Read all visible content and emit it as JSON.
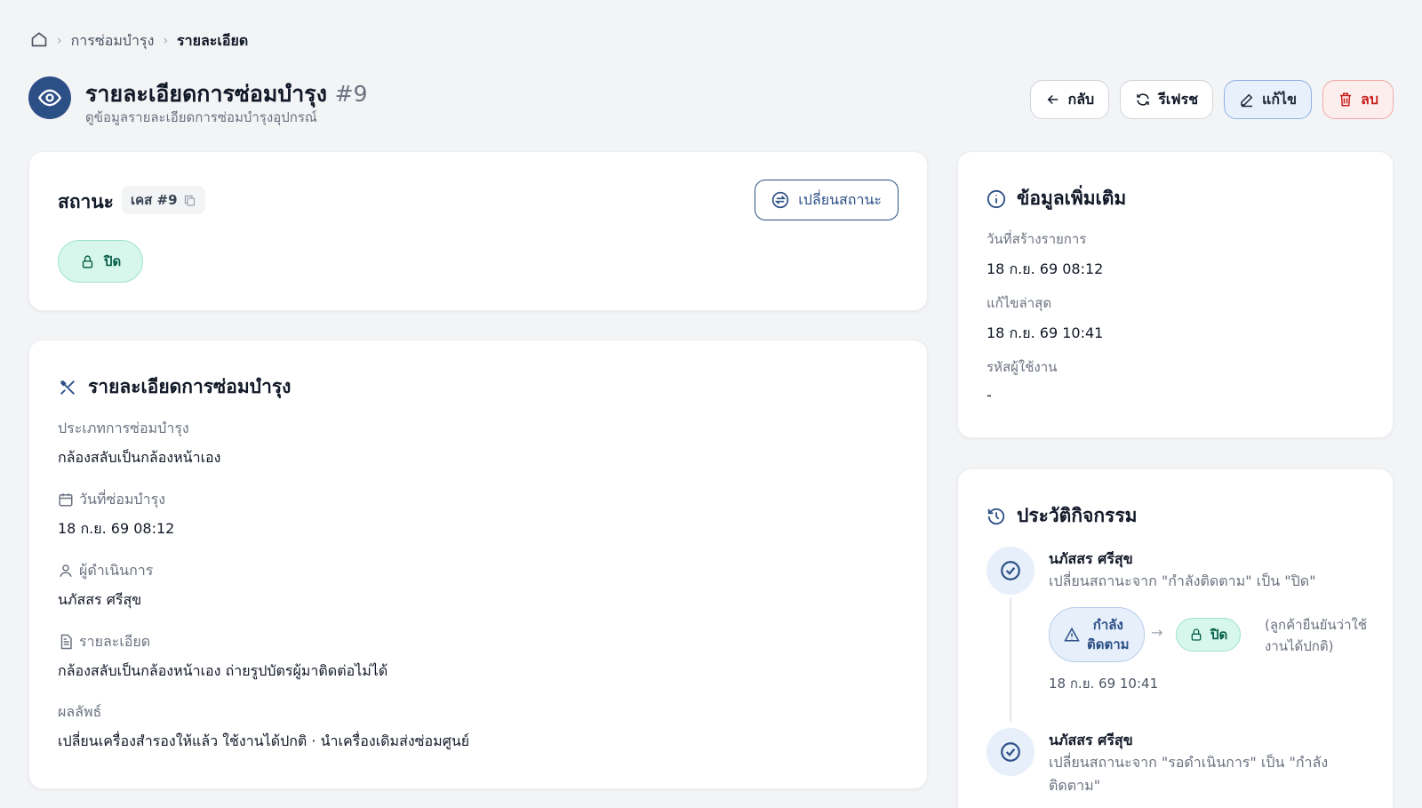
{
  "breadcrumb": {
    "parent": "การซ่อมบำรุง",
    "current": "รายละเอียด"
  },
  "header": {
    "title": "รายละเอียดการซ่อมบำรุง",
    "number": "#9",
    "subtitle": "ดูข้อมูลรายละเอียดการซ่อมบำรุงอุปกรณ์"
  },
  "actions": {
    "back": "กลับ",
    "refresh": "รีเฟรช",
    "edit": "แก้ไข",
    "delete": "ลบ"
  },
  "status": {
    "label": "สถานะ",
    "case": "เคส #9",
    "change_button": "เปลี่ยนสถานะ",
    "current": "ปิด"
  },
  "details": {
    "title": "รายละเอียดการซ่อมบำรุง",
    "type_label": "ประเภทการซ่อมบำรุง",
    "type_value": "กล้องสลับเป็นกล้องหน้าเอง",
    "date_label": "วันที่ซ่อมบำรุง",
    "date_value": "18 ก.ย. 69 08:12",
    "operator_label": "ผู้ดำเนินการ",
    "operator_value": "นภัสสร ศรีสุข",
    "detail_label": "รายละเอียด",
    "detail_value": "กล้องสลับเป็นกล้องหน้าเอง ถ่ายรูปบัตรผู้มาติดต่อไม่ได้",
    "result_label": "ผลลัพธ์",
    "result_value": "เปลี่ยนเครื่องสำรองให้แล้ว ใช้งานได้ปกติ · นำเครื่องเดิมส่งซ่อมศูนย์"
  },
  "info": {
    "title": "ข้อมูลเพิ่มเติม",
    "created_label": "วันที่สร้างรายการ",
    "created_value": "18 ก.ย. 69 08:12",
    "updated_label": "แก้ไขล่าสุด",
    "updated_value": "18 ก.ย. 69 10:41",
    "user_label": "รหัสผู้ใช้งาน",
    "user_value": "-"
  },
  "activity": {
    "title": "ประวัติกิจกรรม",
    "items": [
      {
        "name": "นภัสสร ศรีสุข",
        "desc": "เปลี่ยนสถานะจาก \"กำลังติดตาม\" เป็น \"ปิด\"",
        "from_line1": "กำลัง",
        "from_line2": "ติดตาม",
        "to": "ปิด",
        "note": "(ลูกค้ายืนยันว่าใช้งานได้ปกติ)",
        "time": "18 ก.ย. 69 10:41"
      },
      {
        "name": "นภัสสร ศรีสุข",
        "desc": "เปลี่ยนสถานะจาก \"รอดำเนินการ\" เป็น \"กำลังติดตาม\""
      }
    ]
  },
  "colors": {
    "primary": "#2c4f86",
    "success_bg": "#d7f6ec",
    "danger": "#c81e1e"
  }
}
